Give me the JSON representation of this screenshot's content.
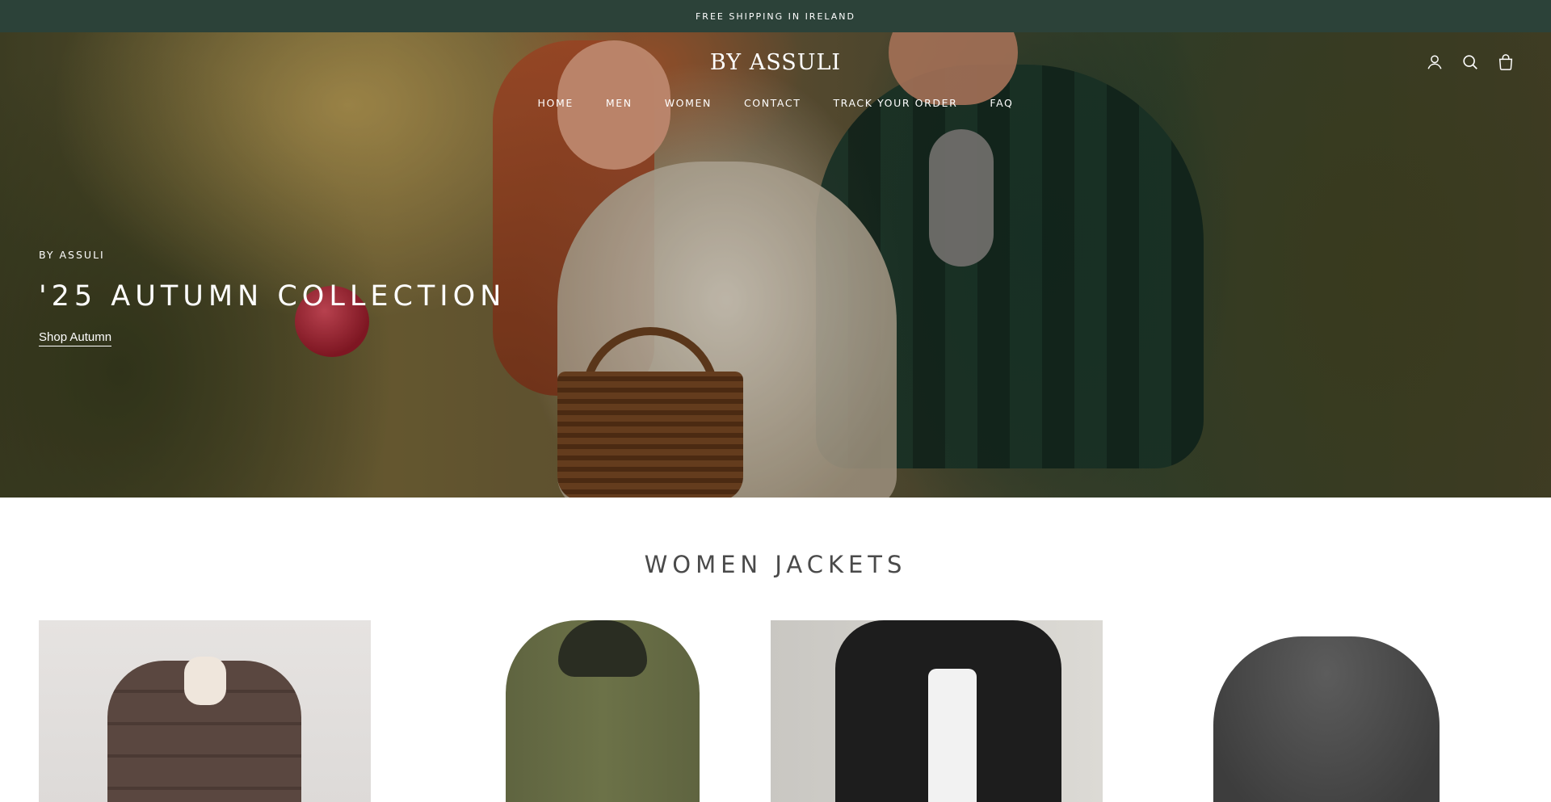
{
  "announcement": {
    "text": "FREE SHIPPING IN IRELAND"
  },
  "header": {
    "logo": "BY ASSULI",
    "nav": [
      "HOME",
      "MEN",
      "WOMEN",
      "CONTACT",
      "TRACK YOUR ORDER",
      "FAQ"
    ],
    "icons": [
      "account-icon",
      "search-icon",
      "cart-icon"
    ]
  },
  "hero": {
    "eyebrow": "BY ASSULI",
    "title": "'25 AUTUMN COLLECTION",
    "link": "Shop Autumn"
  },
  "collection": {
    "title": "WOMEN JACKETS",
    "products": [
      "puffer-jacket",
      "green-parka",
      "black-utility-jacket",
      "grey-wool-coat"
    ]
  },
  "colors": {
    "announcement_bg": "#2c4239",
    "text_light": "#ffffff",
    "section_title": "#4a4a4a"
  }
}
